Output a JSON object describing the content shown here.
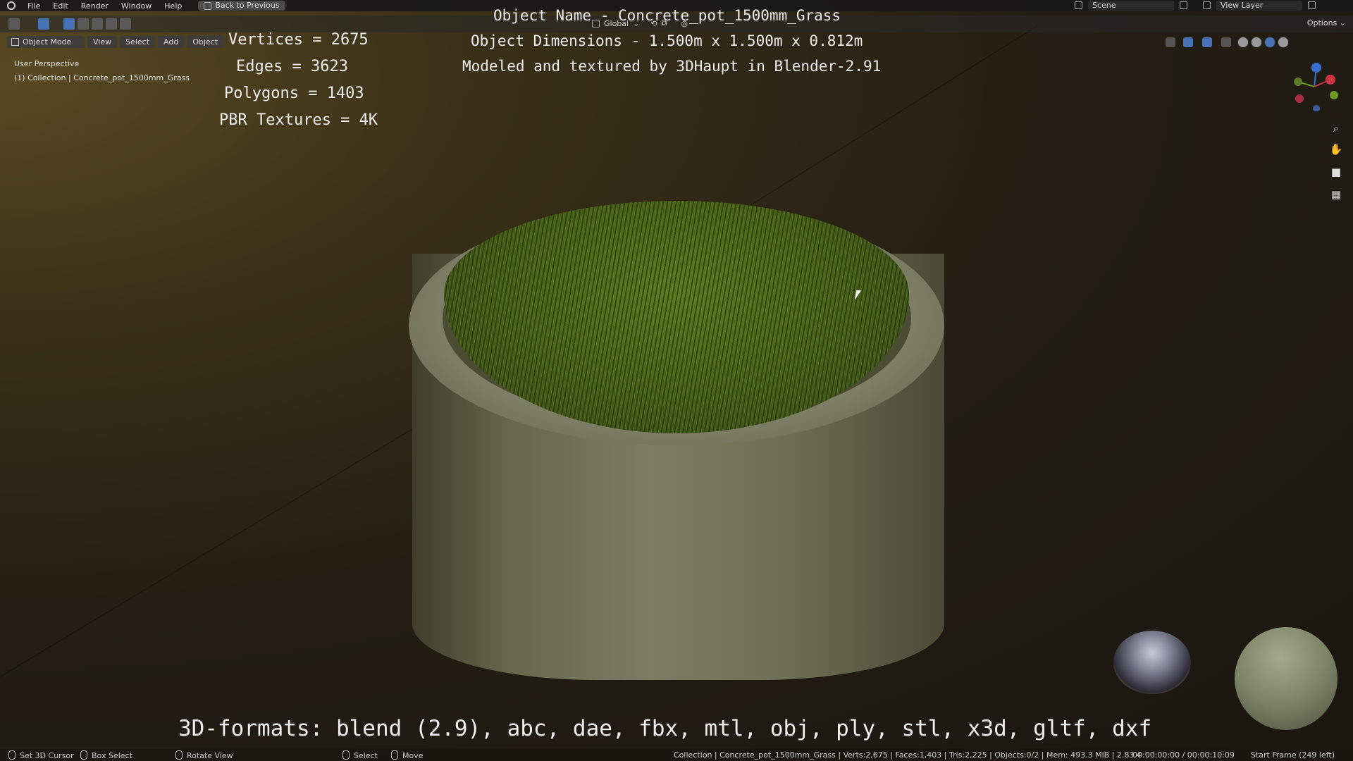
{
  "menubar": {
    "items": [
      "File",
      "Edit",
      "Render",
      "Window",
      "Help"
    ],
    "back_button": "Back to Previous",
    "scene_label": "Scene",
    "view_layer_label": "View Layer"
  },
  "toolbar": {
    "orientation": "Global",
    "options_label": "Options"
  },
  "viewport_header": {
    "mode": "Object Mode",
    "menus": [
      "View",
      "Select",
      "Add",
      "Object"
    ]
  },
  "viewport_overlay": {
    "perspective": "User Perspective",
    "collection": "(1) Collection | Concrete_pot_1500mm_Grass"
  },
  "stats": {
    "vertices": "Vertices = 2675",
    "edges": "Edges = 3623",
    "polygons": "Polygons = 1403",
    "textures": "PBR Textures = 4K"
  },
  "info": {
    "object_name": "Object Name - Concrete_pot_1500mm_Grass",
    "dimensions": "Object Dimensions -  1.500m x 1.500m x 0.812m",
    "credit": "Modeled and textured by 3DHaupt in Blender-2.91"
  },
  "formats_line": "3D-formats: blend (2.9), abc, dae, fbx, mtl, obj, ply, stl, x3d, gltf, dxf",
  "statusbar": {
    "set_cursor": "Set 3D Cursor",
    "box_select": "Box Select",
    "rotate_view": "Rotate View",
    "select": "Select",
    "move": "Move",
    "scene_stats": "Collection | Concrete_pot_1500mm_Grass | Verts:2,675 | Faces:1,403 | Tris:2,225 | Objects:0/2 | Mem: 493.3 MiB | 2.83.4",
    "time": "00:00:00:00 / 00:00:10:09",
    "frame": "Start Frame (249 left)"
  },
  "colors": {
    "accent": "#4772b3",
    "grass": "#4a6418",
    "concrete": "#7c7d62"
  }
}
